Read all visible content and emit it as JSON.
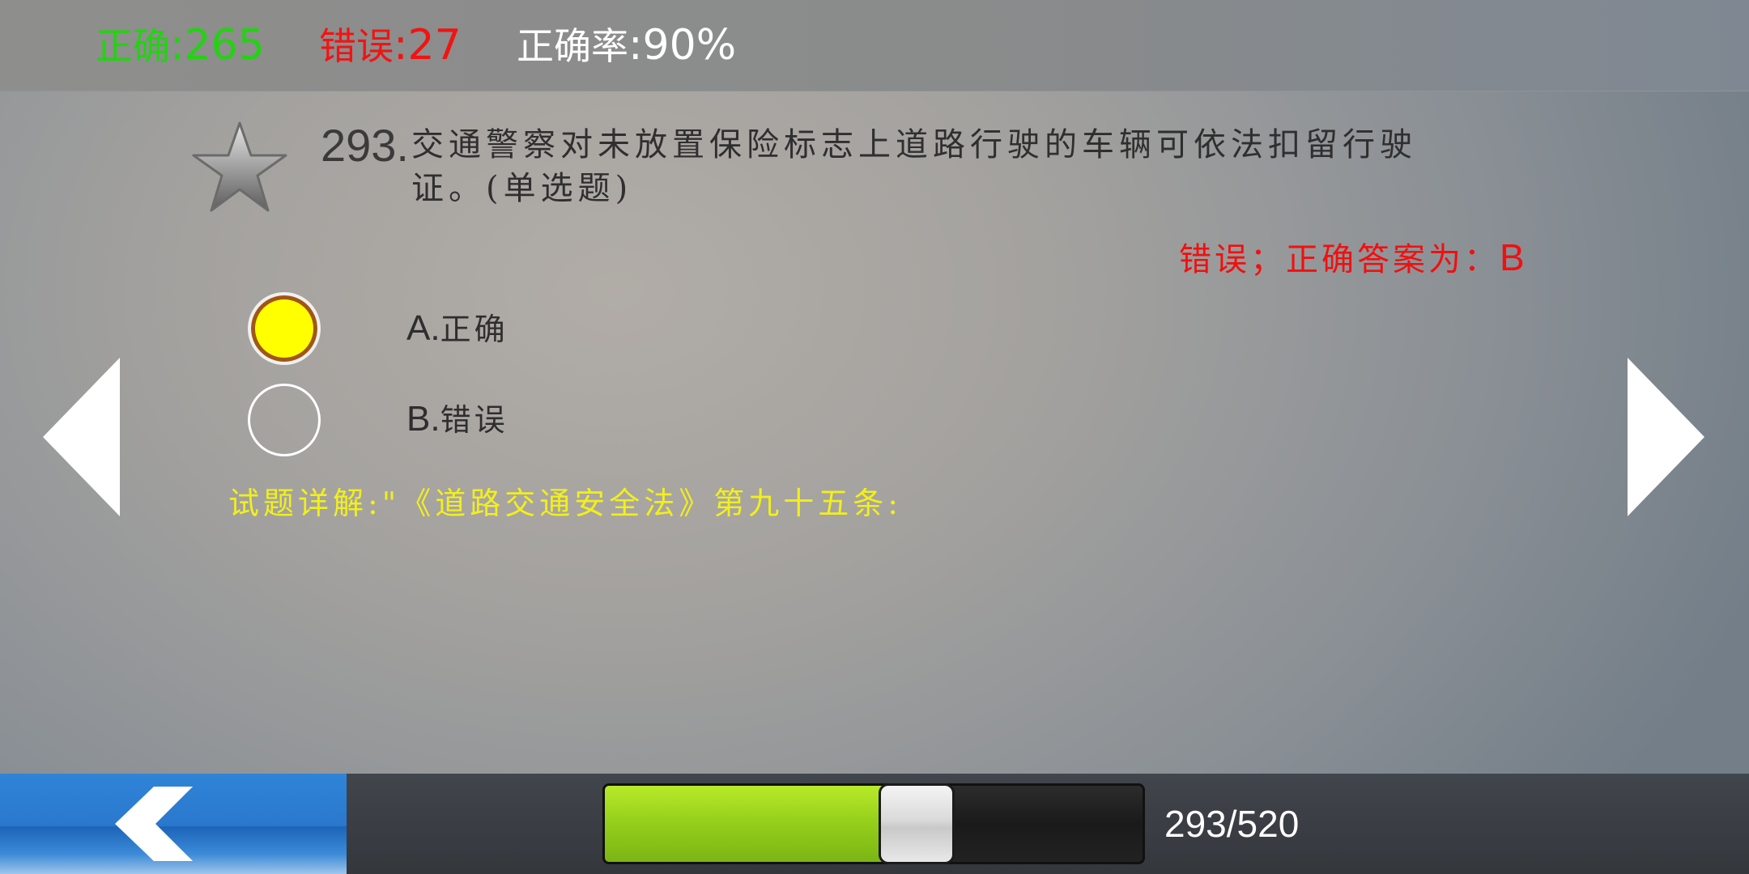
{
  "stats": {
    "correct_label": "正确",
    "correct_value": ":265",
    "wrong_label": "错误",
    "wrong_value": ":27",
    "rate_label": "正确率",
    "rate_value": ":90%"
  },
  "question": {
    "number": "293.",
    "text": "交通警察对未放置保险标志上道路行驶的车辆可依法扣留行驶证。(单选题)",
    "favorite_icon": "star-icon"
  },
  "result": {
    "text": "错误；正确答案为：",
    "answer": "B"
  },
  "options": [
    {
      "key": "A.",
      "text": "正确",
      "selected": true
    },
    {
      "key": "B.",
      "text": "错误",
      "selected": false
    }
  ],
  "explanation": "试题详解:\"《道路交通安全法》第九十五条:",
  "navigation": {
    "prev_icon": "triangle-left-icon",
    "next_icon": "triangle-right-icon",
    "back_icon": "chevron-left-icon"
  },
  "progress": {
    "current": 293,
    "total": 520,
    "label": "293/520",
    "fill_color": "#9ad41e"
  },
  "colors": {
    "correct": "#22d311",
    "wrong": "#f21313",
    "explanation": "#f2ef1c",
    "selected_option": "#ffff00",
    "back_button": "#2a78cd"
  }
}
